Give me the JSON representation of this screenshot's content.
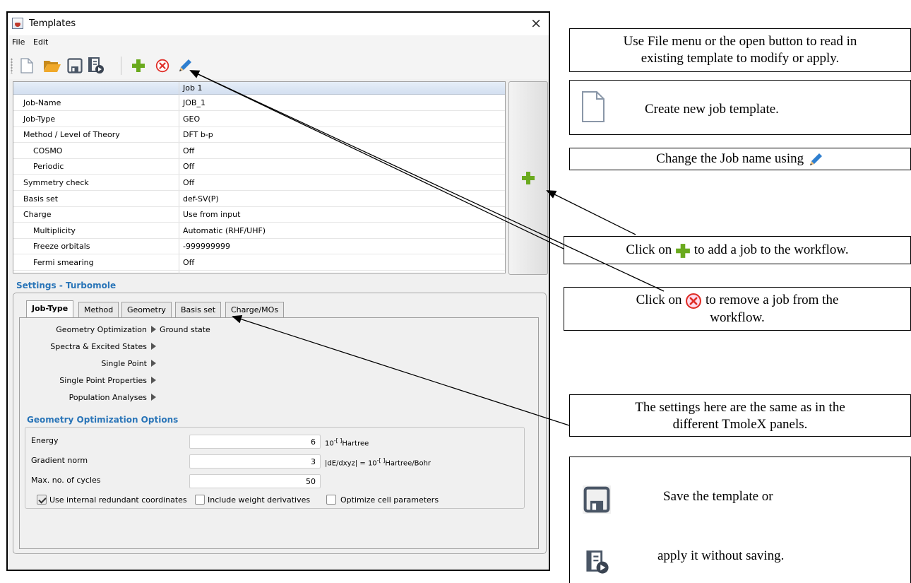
{
  "window": {
    "title": "Templates",
    "close_glyph": "×",
    "menu": [
      "File",
      "Edit"
    ]
  },
  "toolbar": {
    "buttons": [
      {
        "name": "new-icon",
        "tip": "new"
      },
      {
        "name": "open-folder-icon",
        "tip": "open"
      },
      {
        "name": "save-icon",
        "tip": "save"
      },
      {
        "name": "apply-icon",
        "tip": "apply"
      },
      {
        "name": "plus-icon",
        "tip": "add job"
      },
      {
        "name": "remove-icon",
        "tip": "remove job"
      },
      {
        "name": "pencil-icon",
        "tip": "rename job"
      }
    ]
  },
  "jobs_table": {
    "column_header": "Job 1",
    "rows": [
      {
        "label": "Job-Name",
        "value": "JOB_1",
        "indent": false
      },
      {
        "label": "Job-Type",
        "value": "GEO",
        "indent": false
      },
      {
        "label": "Method / Level of Theory",
        "value": "DFT b-p",
        "indent": false
      },
      {
        "label": "COSMO",
        "value": "Off",
        "indent": true
      },
      {
        "label": "Periodic",
        "value": "Off",
        "indent": true
      },
      {
        "label": "Symmetry check",
        "value": "Off",
        "indent": false
      },
      {
        "label": "Basis set",
        "value": "def-SV(P)",
        "indent": false
      },
      {
        "label": "Charge",
        "value": "Use from input",
        "indent": false
      },
      {
        "label": "Multiplicity",
        "value": "Automatic (RHF/UHF)",
        "indent": true
      },
      {
        "label": "Freeze orbitals",
        "value": "-999999999",
        "indent": true
      },
      {
        "label": "Fermi smearing",
        "value": "Off",
        "indent": true
      }
    ]
  },
  "settings": {
    "title": "Settings - Turbomole",
    "tabs": [
      "Job-Type",
      "Method",
      "Geometry",
      "Basis set",
      "Charge/MOs"
    ],
    "active_tab": "Job-Type",
    "job_types": [
      {
        "label": "Geometry Optimization",
        "value": "Ground state"
      },
      {
        "label": "Spectra & Excited States",
        "value": ""
      },
      {
        "label": "Single Point",
        "value": ""
      },
      {
        "label": "Single Point Properties",
        "value": ""
      },
      {
        "label": "Population Analyses",
        "value": ""
      }
    ],
    "geo_options_title": "Geometry Optimization Options",
    "energy": {
      "label": "Energy",
      "value": "6",
      "unit_base": "10",
      "unit_sup": "-[ ]",
      "unit_tail": "Hartree"
    },
    "gradient": {
      "label": "Gradient norm",
      "value": "3",
      "unit_prefix": "|dE/dxyz| = 10",
      "unit_sup": "-[ ]",
      "unit_tail": "Hartree/Bohr"
    },
    "cycles": {
      "label": "Max. no. of cycles",
      "value": "50"
    },
    "checkboxes": [
      {
        "label": "Use internal redundant coordinates",
        "checked": true
      },
      {
        "label": "Include weight derivatives",
        "checked": false
      },
      {
        "label": "Optimize cell parameters",
        "checked": false
      }
    ]
  },
  "annotations": {
    "open_note_1": "Use File menu or the open button to read in",
    "open_note_2": "existing template to modify or apply.",
    "new_note": "Create new job template.",
    "rename_note": "Change the Job name using",
    "add_note_pre": "Click on",
    "add_note_post": "to add a job to the workflow.",
    "remove_note_pre": "Click on",
    "remove_note_post": "to remove a job from the",
    "remove_note_2": "workflow.",
    "settings_note_1": "The settings here are the same as in the",
    "settings_note_2": "different TmoleX panels.",
    "save_note": "Save the template or",
    "apply_note": "apply it without saving."
  },
  "colors": {
    "accent_blue": "#2a75b8",
    "plus_green": "#6aaa1e",
    "remove_red": "#e0302a",
    "pencil_blue": "#2f7fcf"
  }
}
